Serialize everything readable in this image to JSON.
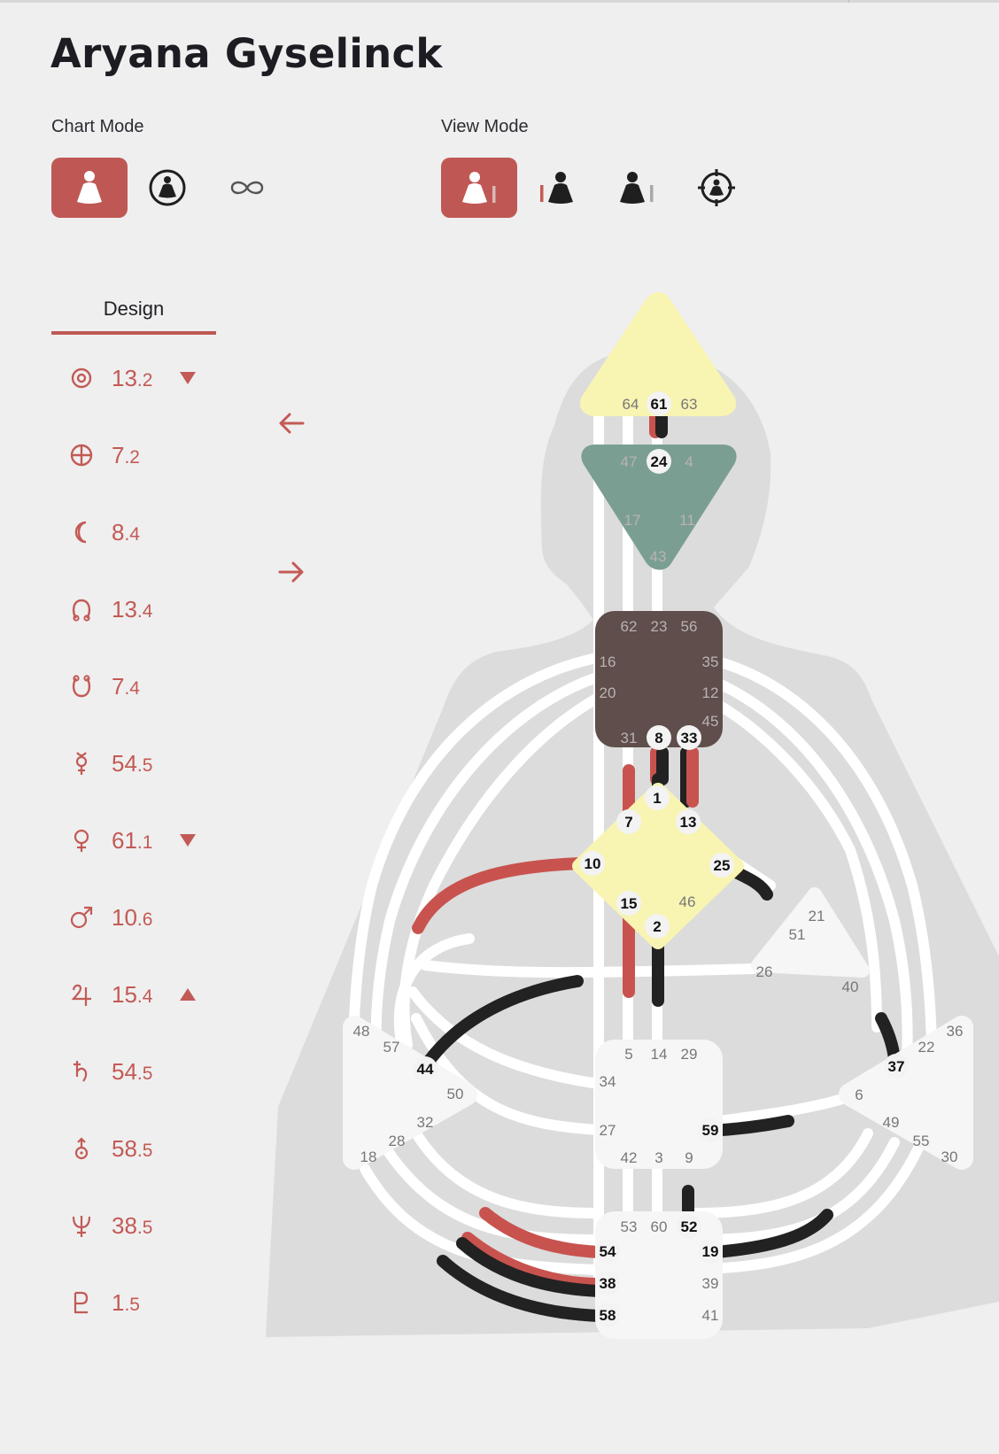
{
  "person_name": "Aryana Gyselinck",
  "chart_mode": {
    "label": "Chart Mode",
    "options": [
      {
        "icon": "design-figure-icon",
        "active": true
      },
      {
        "icon": "circled-figure-icon",
        "active": false
      },
      {
        "icon": "infinity-icon",
        "active": false
      }
    ]
  },
  "view_mode": {
    "label": "View Mode",
    "options": [
      {
        "icon": "figure-right-bar-icon",
        "active": true
      },
      {
        "icon": "left-bar-figure-icon",
        "active": false
      },
      {
        "icon": "figure-gray-bar-icon",
        "active": false
      },
      {
        "icon": "crosshair-figure-icon",
        "active": false
      }
    ]
  },
  "design_tab": "Design",
  "planets": [
    {
      "icon": "sun-icon",
      "gate": "13",
      "line": ".2",
      "indicator": "down"
    },
    {
      "icon": "earth-icon",
      "gate": "7",
      "line": ".2",
      "indicator": ""
    },
    {
      "icon": "moon-icon",
      "gate": "8",
      "line": ".4",
      "indicator": ""
    },
    {
      "icon": "north-node-icon",
      "gate": "13",
      "line": ".4",
      "indicator": ""
    },
    {
      "icon": "south-node-icon",
      "gate": "7",
      "line": ".4",
      "indicator": ""
    },
    {
      "icon": "mercury-icon",
      "gate": "54",
      "line": ".5",
      "indicator": ""
    },
    {
      "icon": "venus-icon",
      "gate": "61",
      "line": ".1",
      "indicator": "down"
    },
    {
      "icon": "mars-icon",
      "gate": "10",
      "line": ".6",
      "indicator": ""
    },
    {
      "icon": "jupiter-icon",
      "gate": "15",
      "line": ".4",
      "indicator": "up"
    },
    {
      "icon": "saturn-icon",
      "gate": "54",
      "line": ".5",
      "indicator": ""
    },
    {
      "icon": "uranus-icon",
      "gate": "58",
      "line": ".5",
      "indicator": ""
    },
    {
      "icon": "neptune-icon",
      "gate": "38",
      "line": ".5",
      "indicator": ""
    },
    {
      "icon": "pluto-icon",
      "gate": "1",
      "line": ".5",
      "indicator": ""
    }
  ],
  "arrows": {
    "left": "arrow-left-icon",
    "right": "arrow-right-icon"
  },
  "colors": {
    "accent": "#c35a55",
    "design_channel": "#c8534e",
    "personality_channel": "#222222",
    "head_center": "#f8f4b2",
    "ajna_center": "#7b9e93",
    "throat_center": "#5f4e4b",
    "g_center": "#f8f4b2",
    "undefined_center": "#f6f6f6",
    "silhouette": "#dcdcdc"
  },
  "bodygraph": {
    "centers": {
      "head": {
        "color": "#f8f4b2",
        "gates": [
          "64",
          "61",
          "63"
        ]
      },
      "ajna": {
        "color": "#7b9e93",
        "gates": [
          "47",
          "24",
          "4",
          "17",
          "11",
          "43"
        ]
      },
      "throat": {
        "color": "#5f4e4b",
        "gates": [
          "62",
          "23",
          "56",
          "16",
          "35",
          "20",
          "12",
          "45",
          "31",
          "8",
          "33"
        ]
      },
      "g": {
        "color": "#f8f4b2",
        "gates": [
          "1",
          "7",
          "13",
          "10",
          "25",
          "15",
          "46",
          "2"
        ]
      },
      "heart": {
        "color": "#f6f6f6",
        "gates": [
          "21",
          "51",
          "26",
          "40"
        ]
      },
      "spleen": {
        "color": "#f6f6f6",
        "gates": [
          "48",
          "57",
          "44",
          "50",
          "32",
          "28",
          "18"
        ]
      },
      "sacral": {
        "color": "#f6f6f6",
        "gates": [
          "5",
          "14",
          "29",
          "34",
          "27",
          "59",
          "42",
          "3",
          "9"
        ]
      },
      "solar_plexus": {
        "color": "#f6f6f6",
        "gates": [
          "36",
          "22",
          "37",
          "6",
          "49",
          "55",
          "30"
        ]
      },
      "root": {
        "color": "#f6f6f6",
        "gates": [
          "53",
          "60",
          "52",
          "54",
          "19",
          "38",
          "39",
          "58",
          "41"
        ]
      }
    },
    "active_gates": [
      "61",
      "24",
      "8",
      "33",
      "1",
      "7",
      "13",
      "10",
      "25",
      "15",
      "2",
      "44",
      "37",
      "59",
      "52",
      "54",
      "19",
      "38",
      "58"
    ]
  }
}
